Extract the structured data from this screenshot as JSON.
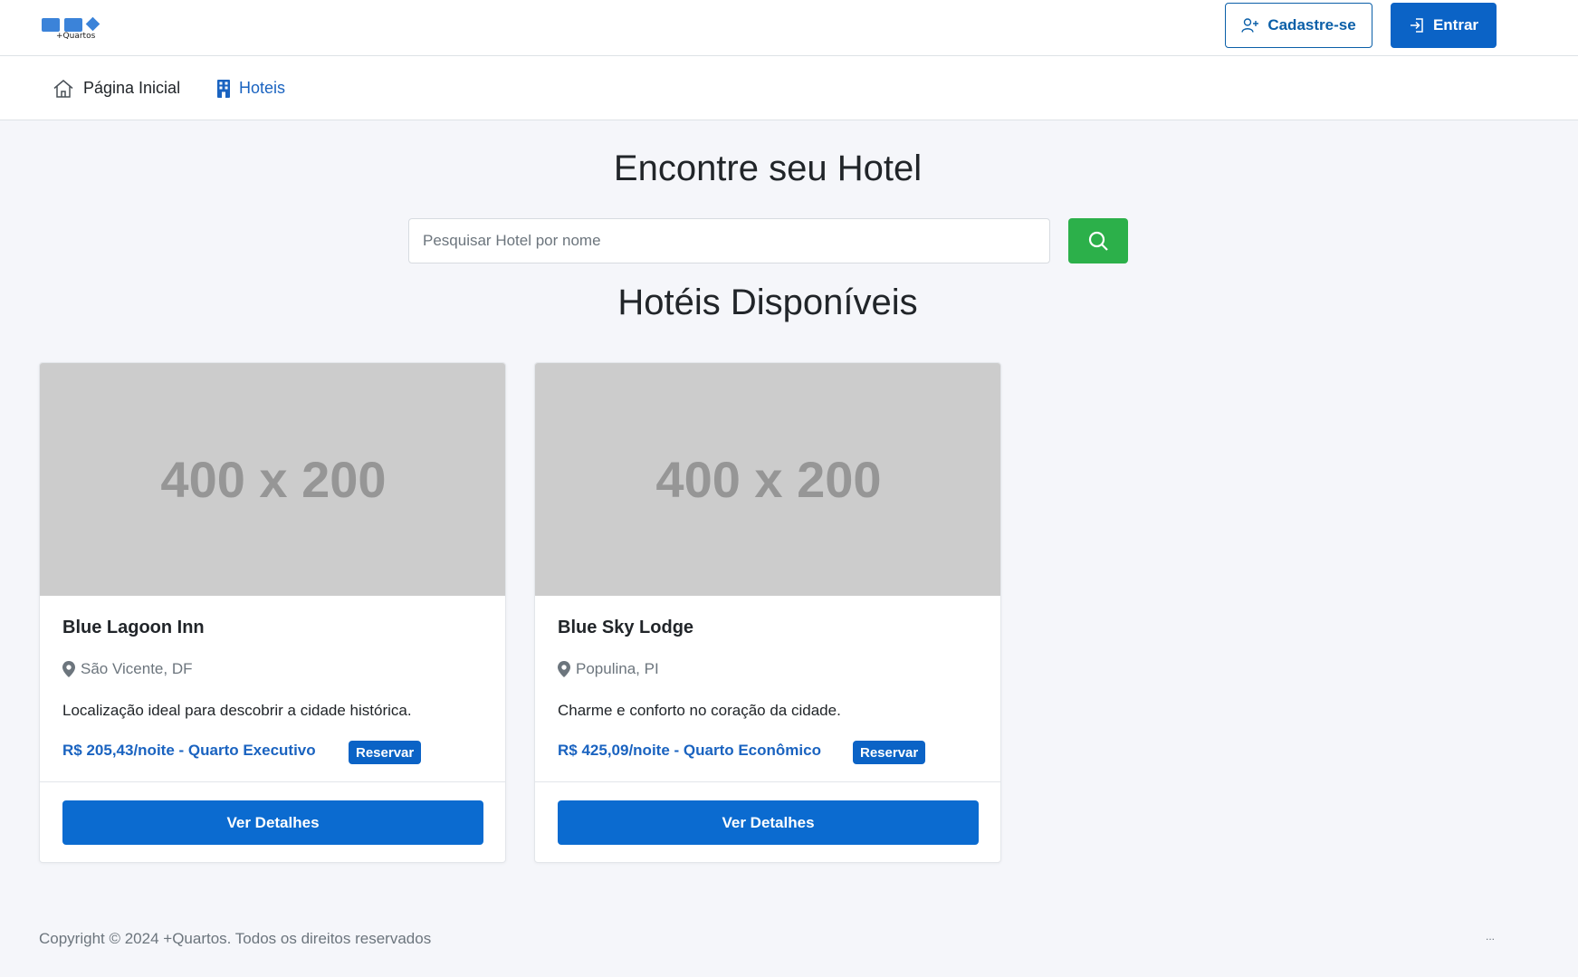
{
  "header": {
    "logo_text": "+Quartos",
    "register_label": "Cadastre-se",
    "login_label": "Entrar",
    "brand_color": "#0b63c6"
  },
  "nav": {
    "home_label": "Página Inicial",
    "hotels_label": "Hoteis",
    "active_color": "#1a63c0"
  },
  "main": {
    "title": "Encontre seu Hotel",
    "search": {
      "placeholder": "Pesquisar Hotel por nome",
      "value": "",
      "button_color": "#2cb04a"
    },
    "section_title": "Hotéis Disponíveis"
  },
  "hotels": [
    {
      "image_text": "400 x 200",
      "name": "Blue Lagoon Inn",
      "location": "São Vicente, DF",
      "description": "Localização ideal para descobrir a cidade histórica.",
      "price": "R$ 205,43/noite - Quarto Executivo",
      "badge": "Reservar",
      "button": "Ver Detalhes"
    },
    {
      "image_text": "400 x 200",
      "name": "Blue Sky Lodge",
      "location": "Populina, PI",
      "description": "Charme e conforto no coração da cidade.",
      "price": "R$ 425,09/noite - Quarto Econômico",
      "badge": "Reservar",
      "button": "Ver Detalhes"
    }
  ],
  "footer": {
    "copyright": "Copyright © 2024 +Quartos. Todos os direitos reservados",
    "extra": "..."
  }
}
